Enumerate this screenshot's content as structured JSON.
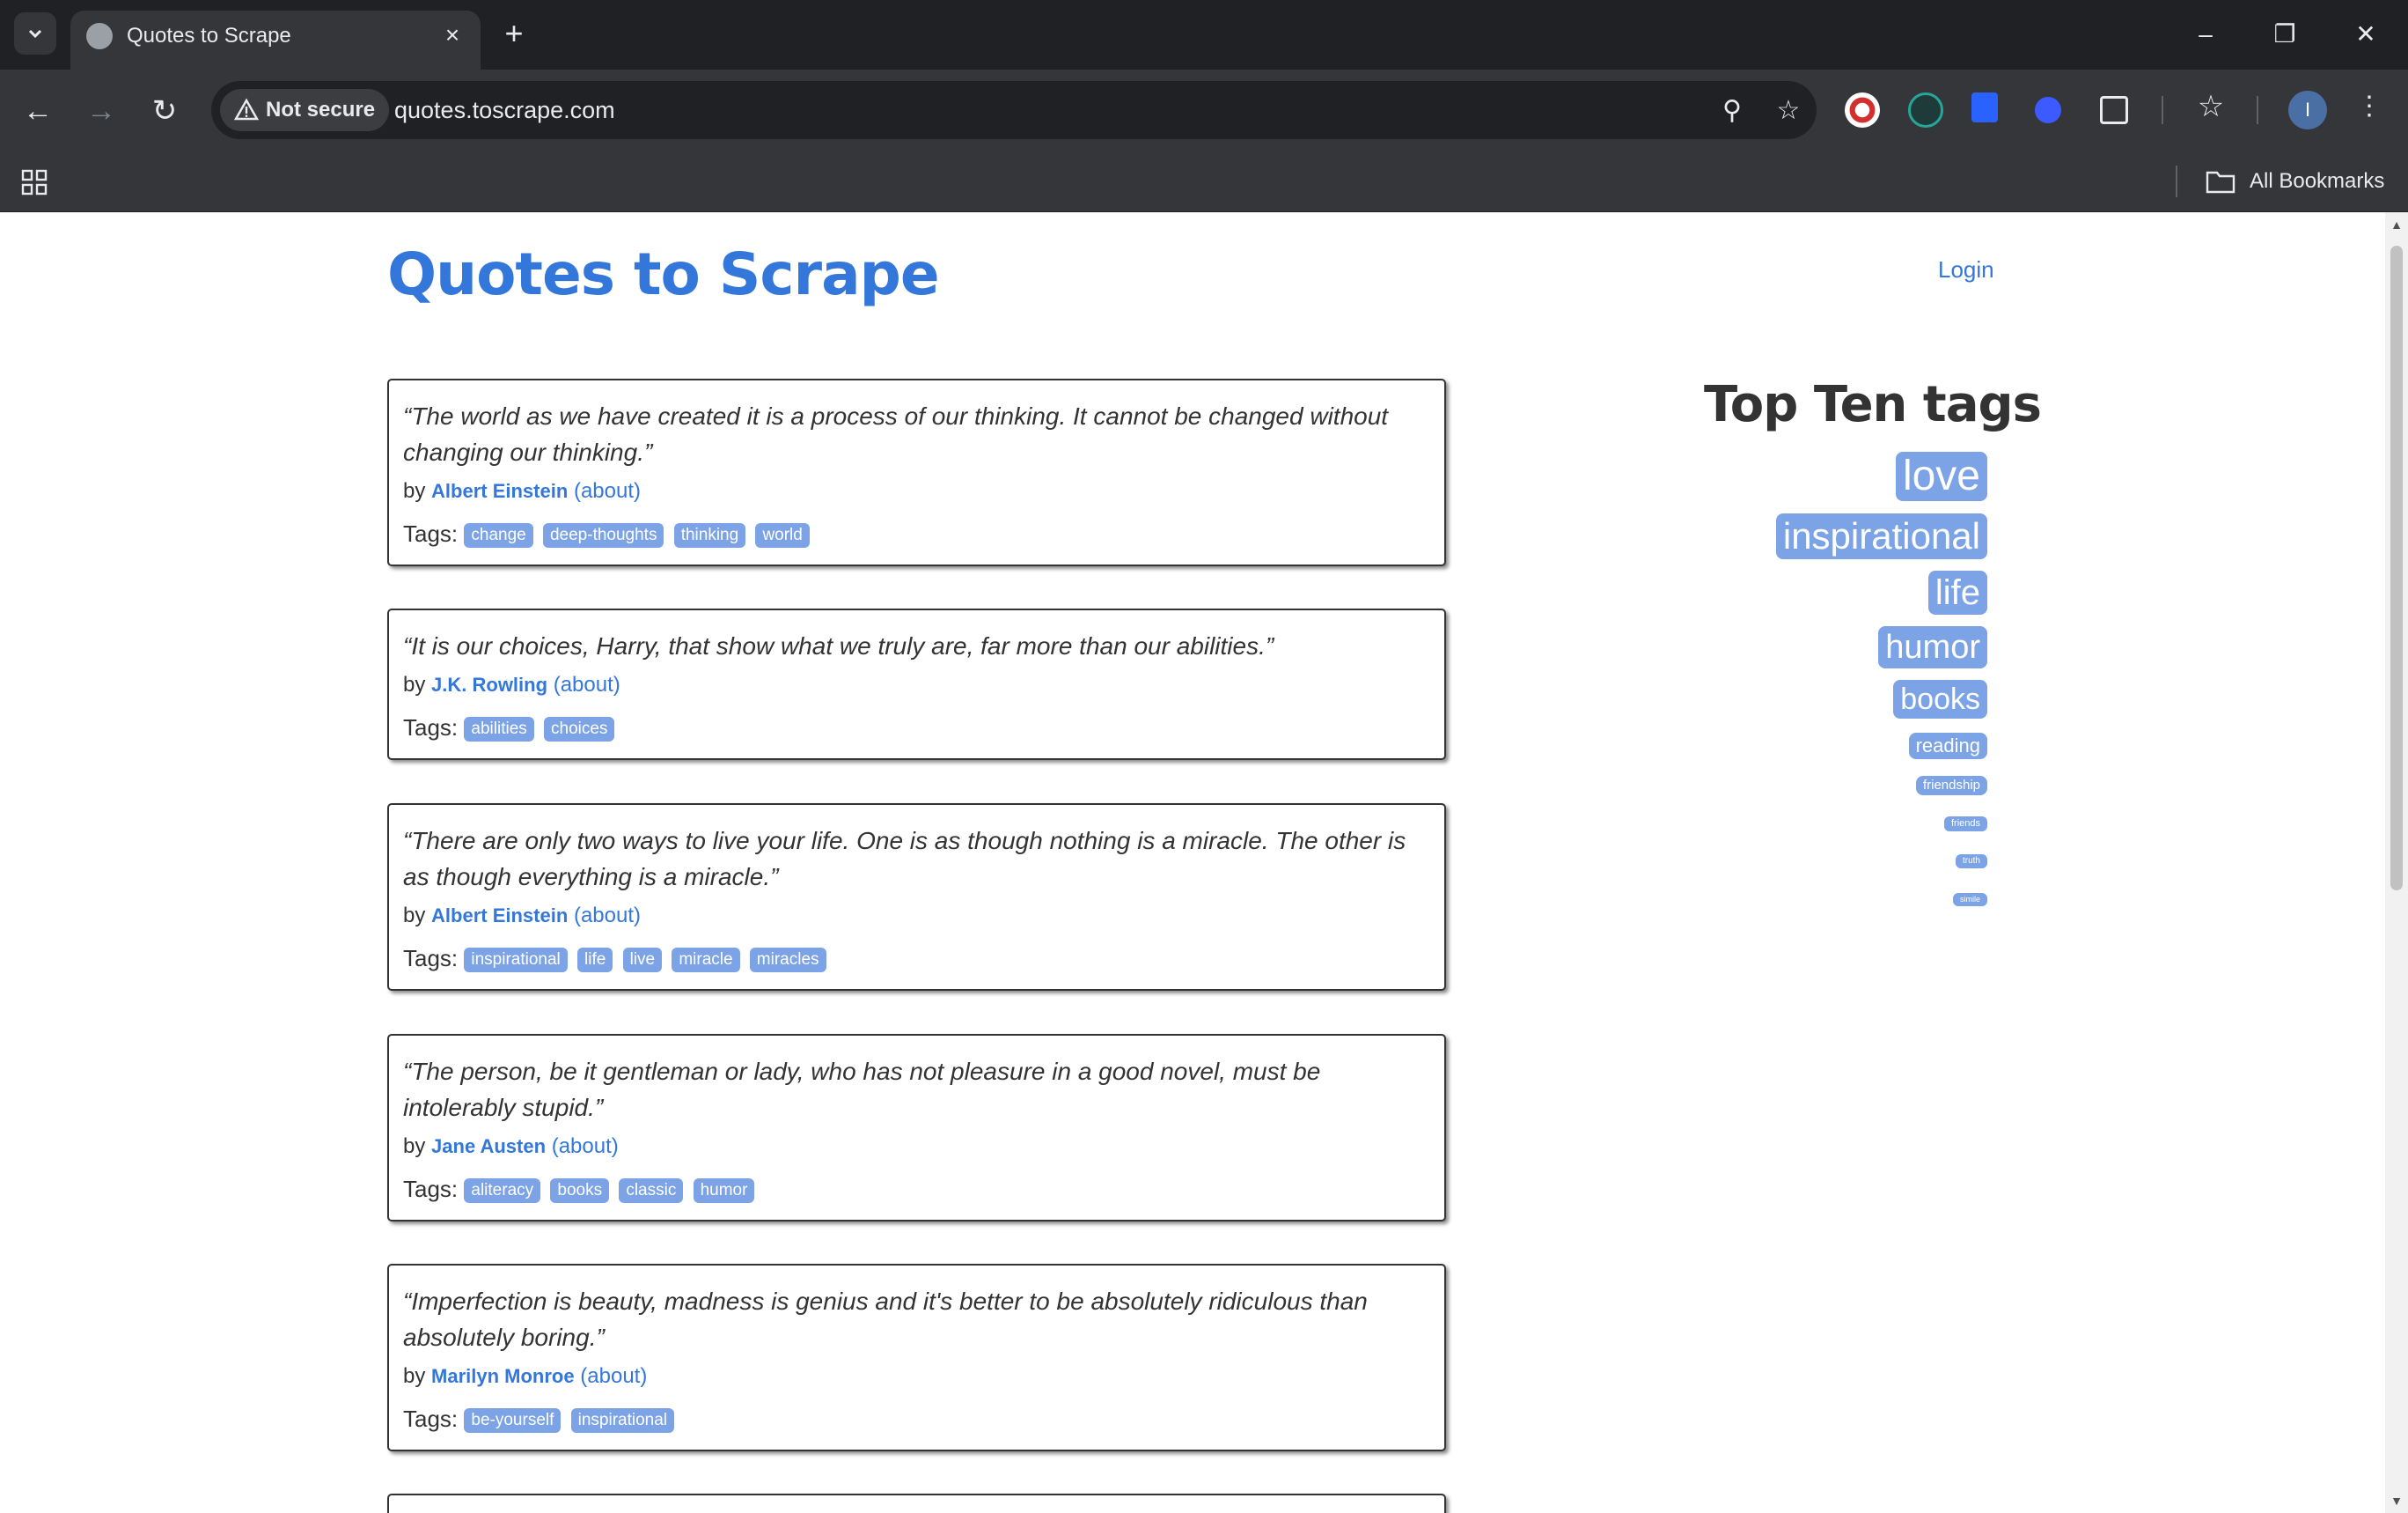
{
  "browser": {
    "tab_title": "Quotes to Scrape",
    "security_label": "Not secure",
    "url": "quotes.toscrape.com",
    "bookmarks_label": "All Bookmarks",
    "profile_initial": "I"
  },
  "page": {
    "site_title": "Quotes to Scrape",
    "login_label": "Login",
    "by_label": "by",
    "about_label": "(about)",
    "tags_label": "Tags:",
    "quotes": [
      {
        "text": "“The world as we have created it is a process of our thinking. It cannot be changed without changing our thinking.”",
        "author": "Albert Einstein",
        "tags": [
          "change",
          "deep-thoughts",
          "thinking",
          "world"
        ]
      },
      {
        "text": "“It is our choices, Harry, that show what we truly are, far more than our abilities.”",
        "author": "J.K. Rowling",
        "tags": [
          "abilities",
          "choices"
        ]
      },
      {
        "text": "“There are only two ways to live your life. One is as though nothing is a miracle. The other is as though everything is a miracle.”",
        "author": "Albert Einstein",
        "tags": [
          "inspirational",
          "life",
          "live",
          "miracle",
          "miracles"
        ]
      },
      {
        "text": "“The person, be it gentleman or lady, who has not pleasure in a good novel, must be intolerably stupid.”",
        "author": "Jane Austen",
        "tags": [
          "aliteracy",
          "books",
          "classic",
          "humor"
        ]
      },
      {
        "text": "“Imperfection is beauty, madness is genius and it's better to be absolutely ridiculous than absolutely boring.”",
        "author": "Marilyn Monroe",
        "tags": [
          "be-yourself",
          "inspirational"
        ]
      }
    ],
    "top_tags_title": "Top Ten tags",
    "top_tags": [
      "love",
      "inspirational",
      "life",
      "humor",
      "books",
      "reading",
      "friendship",
      "friends",
      "truth",
      "simile"
    ]
  },
  "colors": {
    "link_blue": "#3477db",
    "tag_blue": "#7ca3e6",
    "chrome_dark": "#202124",
    "chrome_toolbar": "#35363a"
  }
}
